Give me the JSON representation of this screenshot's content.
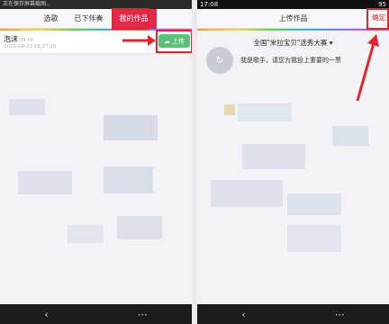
{
  "left": {
    "status_text": "正在保存屏幕截图...",
    "tabs": [
      {
        "label": "选歌"
      },
      {
        "label": "已下伴奏"
      },
      {
        "label": "我的作品"
      }
    ],
    "work": {
      "title": "泡沫",
      "duration": "04:18",
      "date": "2015-09-21 15:27:26",
      "upload_label": "上传"
    },
    "nav": {
      "back": "‹",
      "menu": "⋯"
    }
  },
  "right": {
    "time": "17:08",
    "battery": "95",
    "header_title": "上传作品",
    "confirm_label": "确定",
    "contest": "全国\"米拉宝贝\"选秀大赛",
    "description": "我是歌手，请您为我投上重要的一票",
    "nav": {
      "back": "‹",
      "menu": "⋯"
    }
  },
  "colors": {
    "accent": "#e02a4c",
    "upload": "#5cbf7a",
    "annotation": "#e4232a"
  }
}
